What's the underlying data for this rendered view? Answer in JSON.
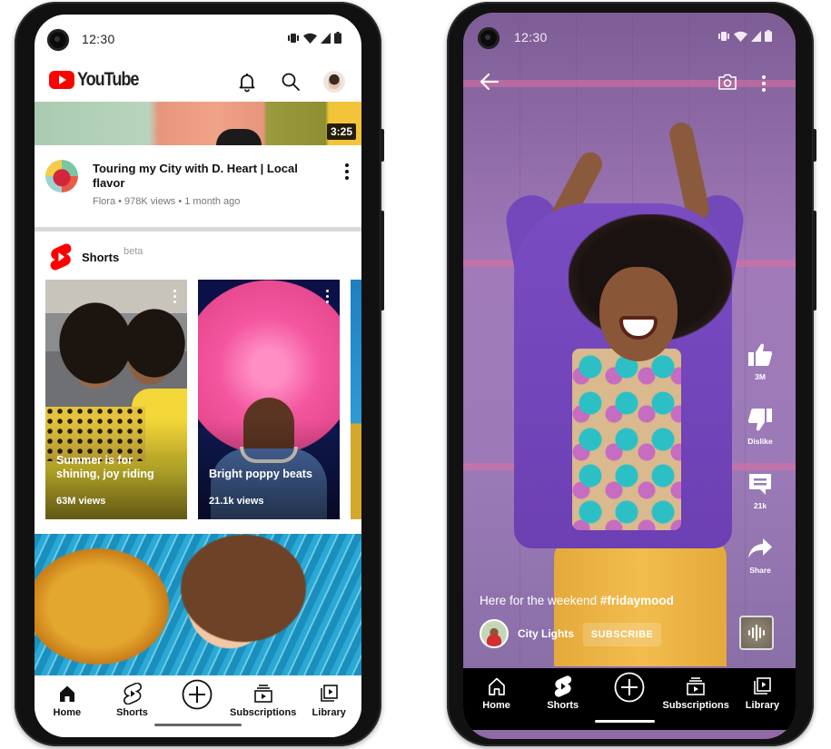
{
  "status_bar": {
    "time": "12:30",
    "icons": [
      "vibrate-icon",
      "wifi-icon",
      "signal-icon",
      "battery-icon"
    ]
  },
  "home_screen": {
    "header": {
      "logo_text": "YouTube",
      "icons": [
        "bell-icon",
        "search-icon",
        "account-avatar"
      ]
    },
    "video": {
      "duration": "3:25",
      "title": "Touring my City with D. Heart | Local flavor",
      "meta": "Flora • 978K views • 1 month ago"
    },
    "shorts_section": {
      "title": "Shorts",
      "badge": "beta",
      "items": [
        {
          "title": "Summer is for shining, joy riding",
          "views": "63M views"
        },
        {
          "title": "Bright poppy beats",
          "views": "21.1k views"
        }
      ]
    }
  },
  "bottom_nav": {
    "items": [
      {
        "label": "Home",
        "icon": "home-icon"
      },
      {
        "label": "Shorts",
        "icon": "shorts-icon"
      },
      {
        "label": "",
        "icon": "create-plus-icon"
      },
      {
        "label": "Subscriptions",
        "icon": "subscriptions-icon"
      },
      {
        "label": "Library",
        "icon": "library-icon"
      }
    ]
  },
  "shorts_player": {
    "top_icons": [
      "back-arrow-icon",
      "camera-icon",
      "more-vert-icon"
    ],
    "actions": [
      {
        "label": "3M",
        "icon": "thumbs-up-icon"
      },
      {
        "label": "Dislike",
        "icon": "thumbs-down-icon"
      },
      {
        "label": "21k",
        "icon": "comment-icon"
      },
      {
        "label": "Share",
        "icon": "share-icon"
      }
    ],
    "caption_text": "Here for the weekend ",
    "caption_hashtag": "#fridaymood",
    "channel_name": "City Lights",
    "subscribe_label": "SUBSCRIBE"
  },
  "colors": {
    "youtube_red": "#FF0000",
    "player_background": "#8F6AA6",
    "nav_dark": "#000000",
    "nav_light": "#FFFFFF"
  }
}
